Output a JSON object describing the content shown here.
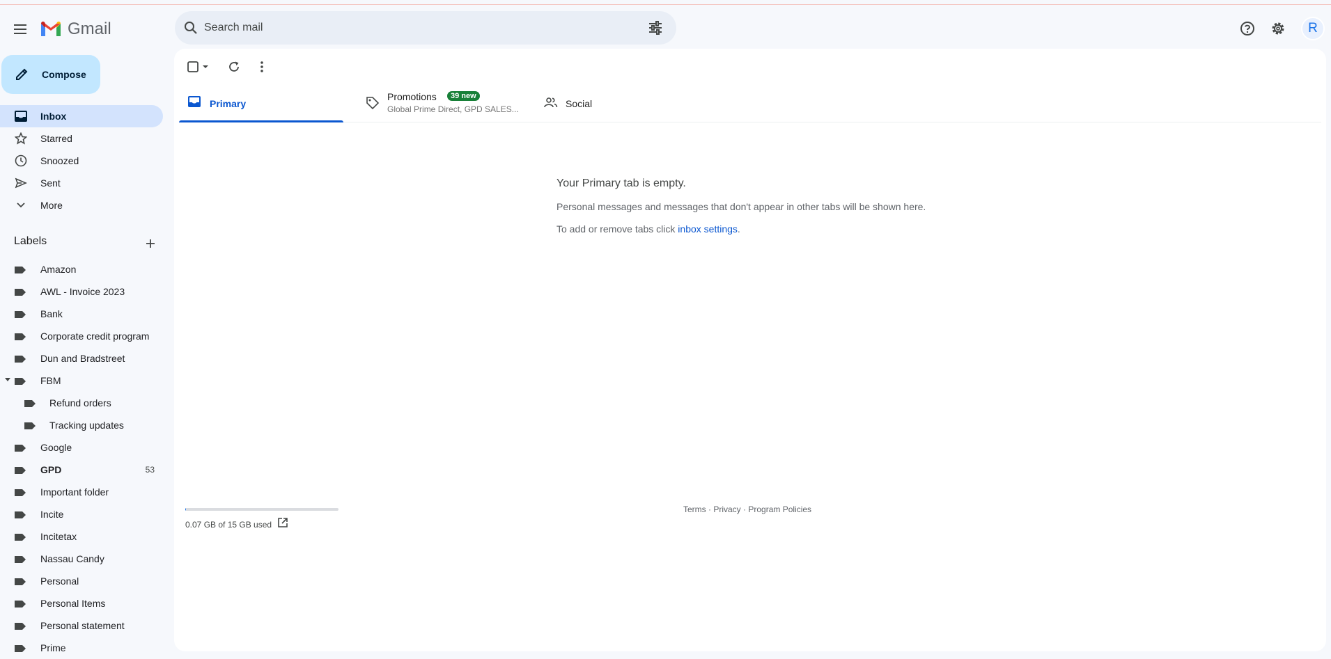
{
  "header": {
    "app_name": "Gmail",
    "search_placeholder": "Search mail",
    "avatar_letter": "R",
    "icons": [
      "menu-icon",
      "search-icon",
      "tune-icon",
      "help-icon",
      "settings-icon"
    ]
  },
  "sidebar": {
    "compose_label": "Compose",
    "nav": [
      {
        "label": "Inbox",
        "icon": "inbox-icon",
        "active": true
      },
      {
        "label": "Starred",
        "icon": "star-icon"
      },
      {
        "label": "Snoozed",
        "icon": "clock-icon"
      },
      {
        "label": "Sent",
        "icon": "send-icon"
      },
      {
        "label": "More",
        "icon": "chevron-down-icon"
      }
    ],
    "labels_heading": "Labels",
    "labels": [
      {
        "label": "Amazon"
      },
      {
        "label": "AWL - Invoice 2023"
      },
      {
        "label": "Bank"
      },
      {
        "label": "Corporate credit program"
      },
      {
        "label": "Dun and Bradstreet"
      },
      {
        "label": "FBM",
        "expanded": true
      },
      {
        "label": "Refund orders",
        "child": true
      },
      {
        "label": "Tracking updates",
        "child": true
      },
      {
        "label": "Google"
      },
      {
        "label": "GPD",
        "count": "53",
        "bold": true
      },
      {
        "label": "Important folder"
      },
      {
        "label": "Incite"
      },
      {
        "label": "Incitetax"
      },
      {
        "label": "Nassau Candy"
      },
      {
        "label": "Personal"
      },
      {
        "label": "Personal Items"
      },
      {
        "label": "Personal statement"
      },
      {
        "label": "Prime"
      }
    ]
  },
  "tabs": {
    "primary": "Primary",
    "promotions": "Promotions",
    "promotions_badge": "39 new",
    "promotions_senders": "Global Prime Direct, GPD SALES...",
    "social": "Social"
  },
  "empty_state": {
    "heading": "Your Primary tab is empty.",
    "line1": "Personal messages and messages that don't appear in other tabs will be shown here.",
    "line2_prefix": "To add or remove tabs click ",
    "line2_link": "inbox settings",
    "line2_suffix": "."
  },
  "footer": {
    "storage_text": "0.07 GB of 15 GB used",
    "storage_fraction": 0.005,
    "terms": "Terms",
    "privacy": "Privacy",
    "policies": "Program Policies",
    "sep": " · "
  },
  "colors": {
    "accent": "#0b57d0",
    "compose_bg": "#c2e7ff",
    "active_nav": "#d3e3fd",
    "badge_green": "#188038",
    "background": "#f6f8fc"
  }
}
